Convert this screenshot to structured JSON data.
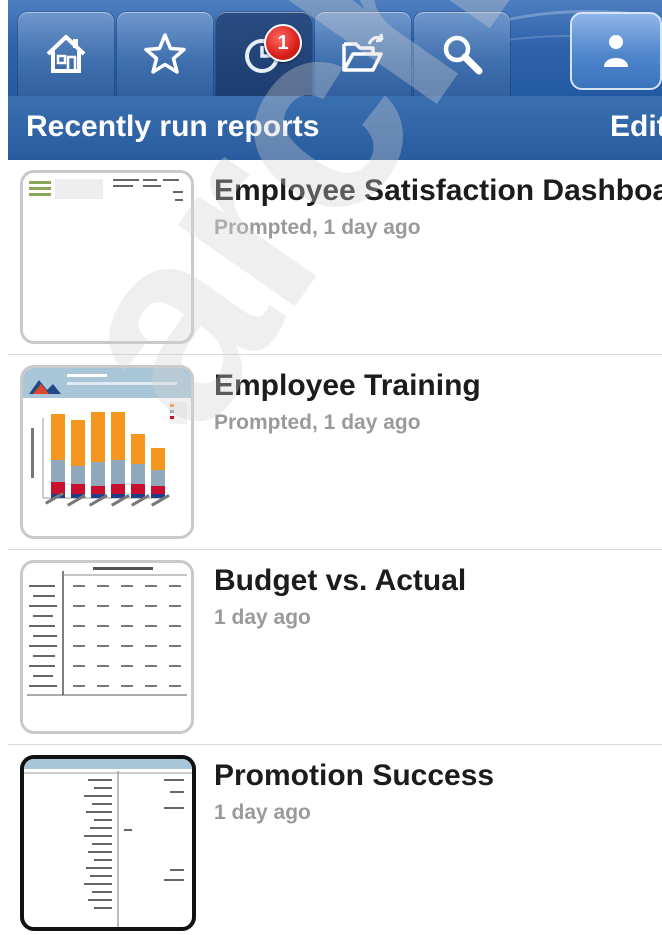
{
  "tabs": [
    {
      "name": "home",
      "icon": "home-icon"
    },
    {
      "name": "favorites",
      "icon": "star-icon"
    },
    {
      "name": "recent",
      "icon": "clock-icon",
      "badge": "1"
    },
    {
      "name": "browse",
      "icon": "folder-open-icon"
    },
    {
      "name": "search",
      "icon": "search-icon"
    }
  ],
  "user_button": {
    "icon": "user-icon"
  },
  "header": {
    "title": "Recently run reports",
    "edit_label": "Edit"
  },
  "reports": [
    {
      "name": "Employee Satisfaction Dashboard",
      "meta": "Prompted, 1 day ago"
    },
    {
      "name": "Employee Training",
      "meta": "Prompted, 1 day ago"
    },
    {
      "name": "Budget vs. Actual",
      "meta": "1 day ago"
    },
    {
      "name": "Promotion Success",
      "meta": "1 day ago"
    }
  ],
  "watermark": "archive",
  "colors": {
    "accent": "#2f64ac",
    "badge": "#d81f1a",
    "bar_orange": "#f5961e",
    "bar_blue": "#8fa8bb",
    "bar_red": "#c8102e"
  }
}
